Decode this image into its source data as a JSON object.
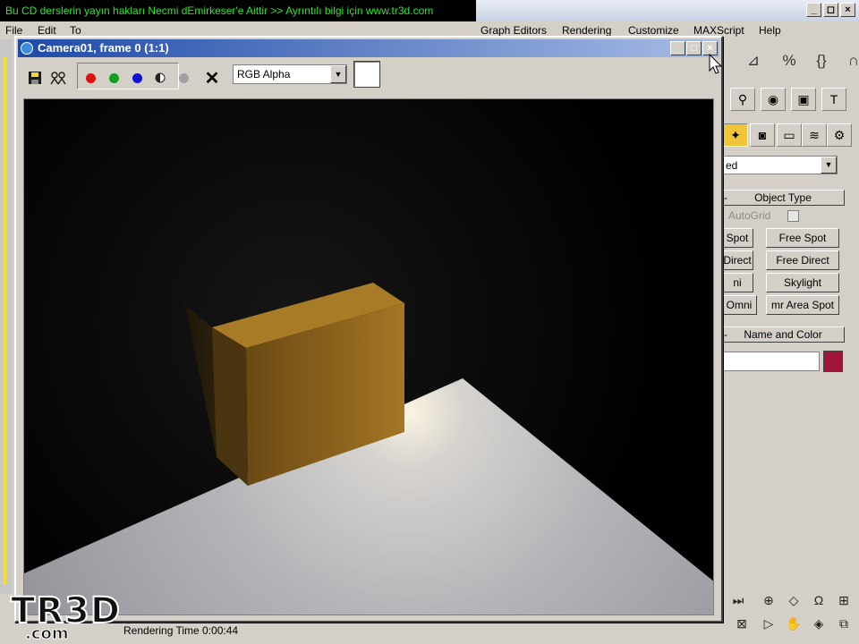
{
  "watermark": {
    "text": "Bu CD derslerin yayın hakları Necmi dEmirkeser'e Aittir >> Ayrıntılı bilgi için  www.tr3d.com"
  },
  "app": {
    "window_controls": [
      "_",
      "◻",
      "×"
    ],
    "menu": [
      "File",
      "Edit",
      "To",
      "Graph Editors",
      "Rendering",
      "Customize",
      "MAXScript",
      "Help"
    ]
  },
  "frame_window": {
    "title": "Camera01, frame 0 (1:1)",
    "title_controls": [
      "_",
      "□",
      "×"
    ],
    "channel_select": {
      "value": "RGB Alpha"
    },
    "clear_label": "✕"
  },
  "command_panel": {
    "category_dropdown": "ed",
    "object_type_rollout": "Object Type",
    "autogrid_label": "AutoGrid",
    "light_buttons": [
      {
        "left": "Spot",
        "right": "Free Spot"
      },
      {
        "left": "Direct",
        "right": "Free Direct"
      },
      {
        "left": "ni",
        "right": "Skylight"
      },
      {
        "left": "Omni",
        "right": "mr Area Spot"
      }
    ],
    "name_color_rollout": "Name and Color",
    "color_swatch": "#a0163b"
  },
  "status": {
    "render_time": "Rendering Time  0:00:44"
  },
  "logo": {
    "main": "TR3D",
    "sub": ".com"
  }
}
